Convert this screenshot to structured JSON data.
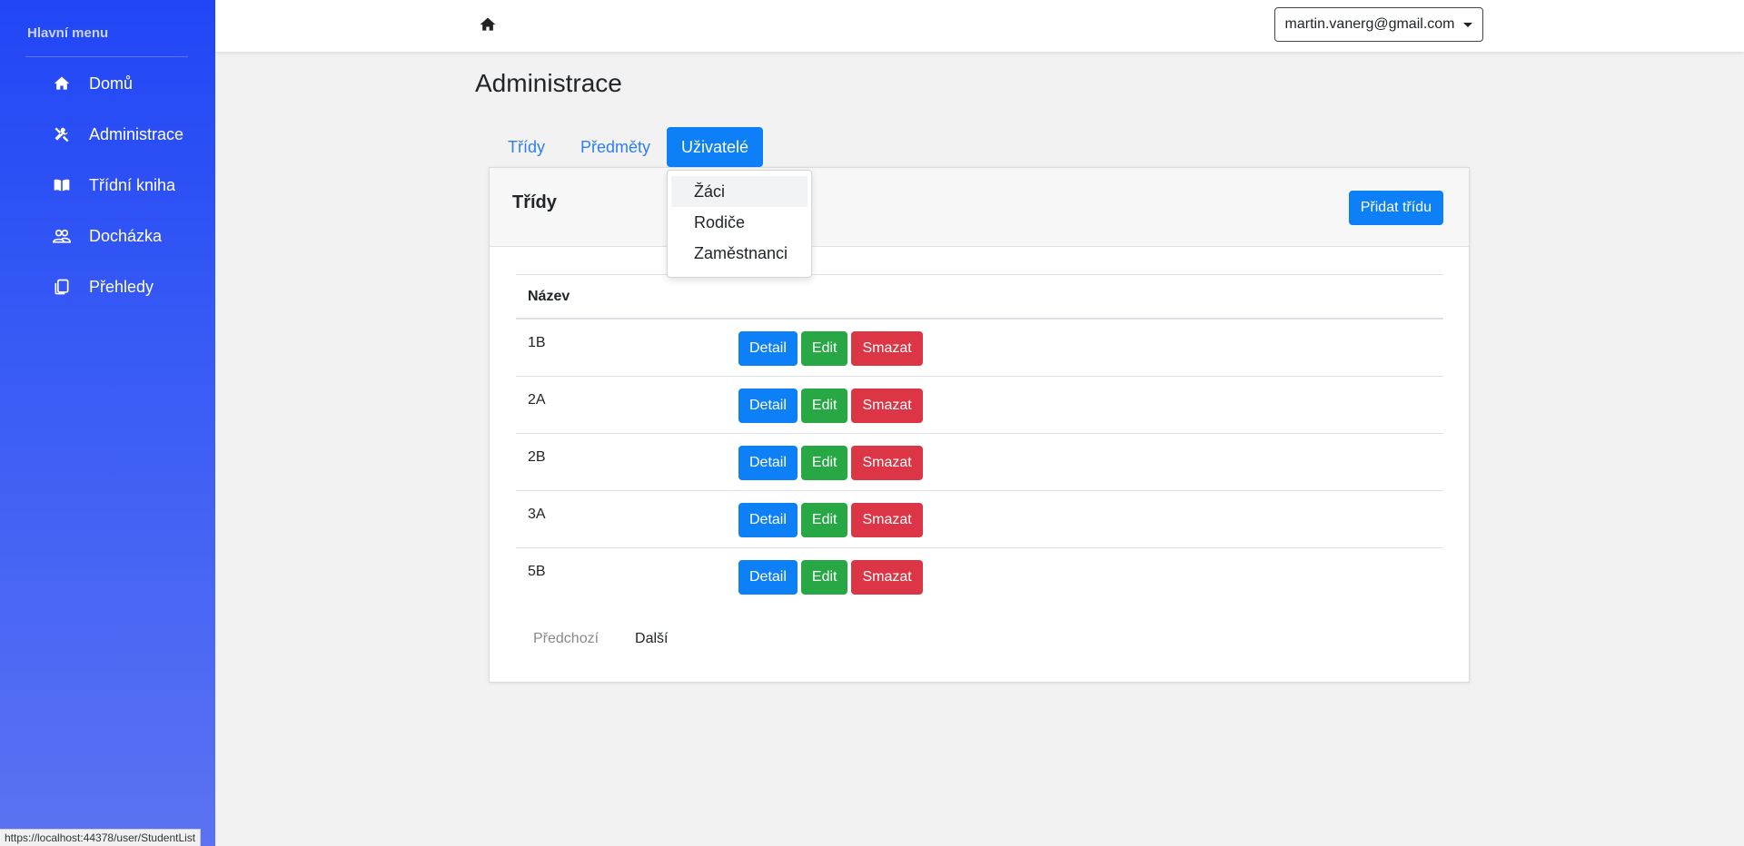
{
  "sidebar": {
    "title": "Hlavní menu",
    "items": [
      {
        "label": "Domů",
        "icon": "home-icon"
      },
      {
        "label": "Administrace",
        "icon": "tools-icon"
      },
      {
        "label": "Třídní kniha",
        "icon": "book-icon"
      },
      {
        "label": "Docházka",
        "icon": "users-icon"
      },
      {
        "label": "Přehledy",
        "icon": "copy-icon"
      }
    ]
  },
  "topbar": {
    "home_icon": "home-icon",
    "user_email": "martin.vanerg@gmail.com"
  },
  "page": {
    "title": "Administrace"
  },
  "tabs": [
    {
      "label": "Třídy",
      "active": false
    },
    {
      "label": "Předměty",
      "active": false
    },
    {
      "label": "Uživatelé",
      "active": true
    }
  ],
  "dropdown": {
    "items": [
      "Žáci",
      "Rodiče",
      "Zaměstnanci"
    ]
  },
  "card": {
    "title": "Třídy",
    "add_button": "Přidat třídu"
  },
  "table": {
    "header": "Název",
    "rows": [
      {
        "name": "1B"
      },
      {
        "name": "2A"
      },
      {
        "name": "2B"
      },
      {
        "name": "3A"
      },
      {
        "name": "5B"
      }
    ],
    "actions": {
      "detail": "Detail",
      "edit": "Edit",
      "delete": "Smazat"
    }
  },
  "pagination": {
    "prev": "Předchozí",
    "next": "Další"
  },
  "colors": {
    "primary": "#0d80f7",
    "success": "#28a745",
    "danger": "#dc3545",
    "sidebar_top": "#2146f5",
    "sidebar_bottom": "#5b73f2"
  },
  "status_bar": {
    "url": "https://localhost:44378/user/StudentList"
  }
}
